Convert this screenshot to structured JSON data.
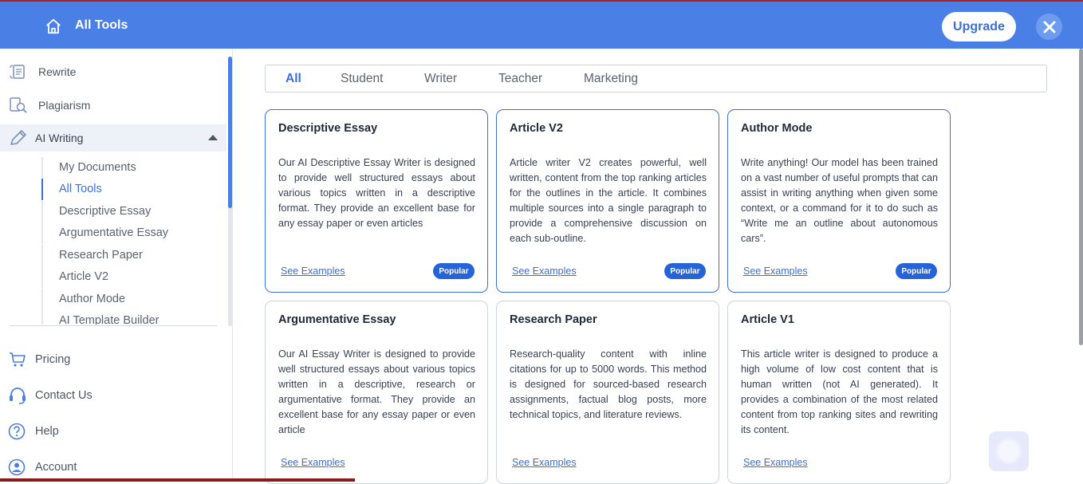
{
  "header": {
    "title": "All Tools",
    "upgrade_label": "Upgrade"
  },
  "sidebar": {
    "items": [
      {
        "label": "Rewrite",
        "icon": "rewrite-icon"
      },
      {
        "label": "Plagiarism",
        "icon": "plagiarism-icon"
      },
      {
        "label": "AI Writing",
        "icon": "pencil-icon"
      }
    ],
    "sub_items": [
      "My Documents",
      "All Tools",
      "Descriptive Essay",
      "Argumentative Essay",
      "Research Paper",
      "Article V2",
      "Author Mode",
      "AI Template Builder"
    ],
    "bottom_items": [
      {
        "label": "Pricing",
        "icon": "cart-icon"
      },
      {
        "label": "Contact Us",
        "icon": "headset-icon"
      },
      {
        "label": "Help",
        "icon": "help-icon"
      },
      {
        "label": "Account",
        "icon": "account-icon"
      }
    ]
  },
  "filters": [
    "All",
    "Student",
    "Writer",
    "Teacher",
    "Marketing"
  ],
  "cards": [
    {
      "title": "Descriptive Essay",
      "description": "Our AI Descriptive Essay Writer is designed to provide well structured essays about various topics written in a descriptive format. They provide an excellent base for any essay paper or even articles",
      "link": "See Examples",
      "badge": "Popular"
    },
    {
      "title": "Article V2",
      "description": "Article writer V2 creates powerful, well written, content from the top ranking articles for the outlines in the article. It combines multiple sources into a single paragraph to provide a comprehensive discussion on each sub-outline.",
      "link": "See Examples",
      "badge": "Popular"
    },
    {
      "title": "Author Mode",
      "description": "Write anything! Our model has been trained on a vast number of useful prompts that can assist in writing anything when given some context, or a command for it to do such as “Write me an outline about autonomous cars”.",
      "link": "See Examples",
      "badge": "Popular"
    },
    {
      "title": "Argumentative Essay",
      "description": "Our AI Essay Writer is designed to provide well structured essays about various topics written in a descriptive, research or argumentative format. They provide an excellent base for any essay paper or even article",
      "link": "See Examples",
      "badge": ""
    },
    {
      "title": "Research Paper",
      "description": "Research-quality content with inline citations for up to 5000 words. This method is designed for sourced-based research assignments, factual blog posts, more technical topics, and literature reviews.",
      "link": "See Examples",
      "badge": ""
    },
    {
      "title": "Article V1",
      "description": "This article writer is designed to produce a high volume of low cost content that is human written (not AI generated). It provides a combination of the most related content from top ranking sites and rewriting its content.",
      "link": "See Examples",
      "badge": ""
    }
  ],
  "colors": {
    "header_bg": "#4a80e6",
    "accent": "#3b6fd6",
    "badge_bg": "#2563d9"
  }
}
